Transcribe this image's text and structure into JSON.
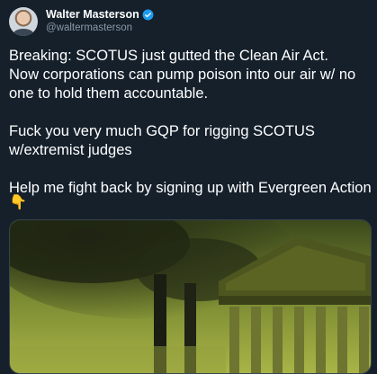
{
  "author": {
    "name": "Walter Masterson",
    "handle": "@waltermasterson"
  },
  "tweet": {
    "text": "Breaking: SCOTUS just gutted the Clean Air Act.\nNow corporations can pump poison into our air w/ no one to hold them accountable.\n\nFuck you very much GQP for rigging SCOTUS w/extremist judges\n\nHelp me fight back by signing up with Evergreen Action",
    "emoji": "👇"
  },
  "icons": {
    "verified": "verified-badge-icon"
  },
  "colors": {
    "background": "#15202b",
    "text": "#ffffff",
    "handle": "#8b98a5",
    "verified": "#1d9bf0"
  }
}
